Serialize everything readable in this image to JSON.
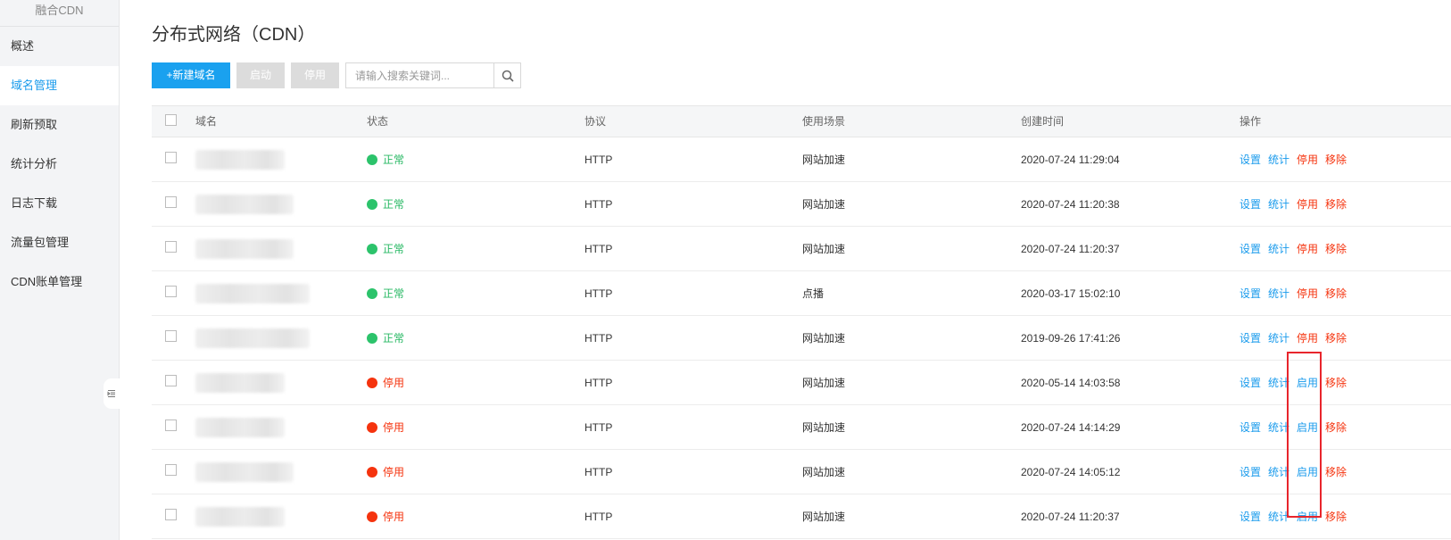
{
  "sidebar": {
    "title": "融合CDN",
    "items": [
      {
        "label": "概述",
        "active": false
      },
      {
        "label": "域名管理",
        "active": true
      },
      {
        "label": "刷新预取",
        "active": false
      },
      {
        "label": "统计分析",
        "active": false
      },
      {
        "label": "日志下载",
        "active": false
      },
      {
        "label": "流量包管理",
        "active": false
      },
      {
        "label": "CDN账单管理",
        "active": false
      }
    ],
    "collapse_icon": "collapse-menu-icon"
  },
  "page": {
    "title": "分布式网络（CDN）"
  },
  "toolbar": {
    "new_label": "+新建域名",
    "enable_label": "启动",
    "disable_label": "停用",
    "search_placeholder": "请输入搜索关键词...",
    "search_icon": "search-icon"
  },
  "table": {
    "headers": [
      "域名",
      "状态",
      "协议",
      "使用场景",
      "创建时间",
      "操作"
    ],
    "ops_labels": {
      "settings": "设置",
      "stats": "统计",
      "disable": "停用",
      "enable": "启用",
      "remove": "移除"
    },
    "rows": [
      {
        "status": "正常",
        "state": "ok",
        "protocol": "HTTP",
        "scene": "网站加速",
        "created": "2020-07-24 11:29:04"
      },
      {
        "status": "正常",
        "state": "ok",
        "protocol": "HTTP",
        "scene": "网站加速",
        "created": "2020-07-24 11:20:38"
      },
      {
        "status": "正常",
        "state": "ok",
        "protocol": "HTTP",
        "scene": "网站加速",
        "created": "2020-07-24 11:20:37"
      },
      {
        "status": "正常",
        "state": "ok",
        "protocol": "HTTP",
        "scene": "点播",
        "created": "2020-03-17 15:02:10"
      },
      {
        "status": "正常",
        "state": "ok",
        "protocol": "HTTP",
        "scene": "网站加速",
        "created": "2019-09-26 17:41:26"
      },
      {
        "status": "停用",
        "state": "stop",
        "protocol": "HTTP",
        "scene": "网站加速",
        "created": "2020-05-14 14:03:58"
      },
      {
        "status": "停用",
        "state": "stop",
        "protocol": "HTTP",
        "scene": "网站加速",
        "created": "2020-07-24 14:14:29"
      },
      {
        "status": "停用",
        "state": "stop",
        "protocol": "HTTP",
        "scene": "网站加速",
        "created": "2020-07-24 14:05:12"
      },
      {
        "status": "停用",
        "state": "stop",
        "protocol": "HTTP",
        "scene": "网站加速",
        "created": "2020-07-24 11:20:37"
      }
    ]
  },
  "colors": {
    "accent": "#1a9bec",
    "primary_button": "#1aa1ef",
    "ok": "#2cc36b",
    "stop": "#f5330e",
    "highlight": "#e8252c"
  }
}
